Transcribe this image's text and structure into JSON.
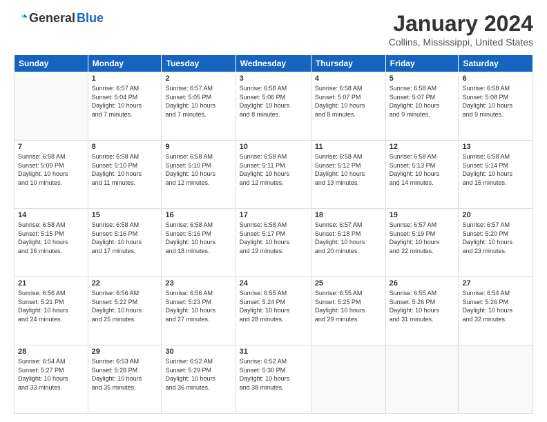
{
  "logo": {
    "general": "General",
    "blue": "Blue"
  },
  "title": "January 2024",
  "location": "Collins, Mississippi, United States",
  "headers": [
    "Sunday",
    "Monday",
    "Tuesday",
    "Wednesday",
    "Thursday",
    "Friday",
    "Saturday"
  ],
  "weeks": [
    [
      {
        "day": "",
        "info": ""
      },
      {
        "day": "1",
        "info": "Sunrise: 6:57 AM\nSunset: 5:04 PM\nDaylight: 10 hours\nand 7 minutes."
      },
      {
        "day": "2",
        "info": "Sunrise: 6:57 AM\nSunset: 5:05 PM\nDaylight: 10 hours\nand 7 minutes."
      },
      {
        "day": "3",
        "info": "Sunrise: 6:58 AM\nSunset: 5:06 PM\nDaylight: 10 hours\nand 8 minutes."
      },
      {
        "day": "4",
        "info": "Sunrise: 6:58 AM\nSunset: 5:07 PM\nDaylight: 10 hours\nand 8 minutes."
      },
      {
        "day": "5",
        "info": "Sunrise: 6:58 AM\nSunset: 5:07 PM\nDaylight: 10 hours\nand 9 minutes."
      },
      {
        "day": "6",
        "info": "Sunrise: 6:58 AM\nSunset: 5:08 PM\nDaylight: 10 hours\nand 9 minutes."
      }
    ],
    [
      {
        "day": "7",
        "info": "Sunrise: 6:58 AM\nSunset: 5:09 PM\nDaylight: 10 hours\nand 10 minutes."
      },
      {
        "day": "8",
        "info": "Sunrise: 6:58 AM\nSunset: 5:10 PM\nDaylight: 10 hours\nand 11 minutes."
      },
      {
        "day": "9",
        "info": "Sunrise: 6:58 AM\nSunset: 5:10 PM\nDaylight: 10 hours\nand 12 minutes."
      },
      {
        "day": "10",
        "info": "Sunrise: 6:58 AM\nSunset: 5:11 PM\nDaylight: 10 hours\nand 12 minutes."
      },
      {
        "day": "11",
        "info": "Sunrise: 6:58 AM\nSunset: 5:12 PM\nDaylight: 10 hours\nand 13 minutes."
      },
      {
        "day": "12",
        "info": "Sunrise: 6:58 AM\nSunset: 5:13 PM\nDaylight: 10 hours\nand 14 minutes."
      },
      {
        "day": "13",
        "info": "Sunrise: 6:58 AM\nSunset: 5:14 PM\nDaylight: 10 hours\nand 15 minutes."
      }
    ],
    [
      {
        "day": "14",
        "info": "Sunrise: 6:58 AM\nSunset: 5:15 PM\nDaylight: 10 hours\nand 16 minutes."
      },
      {
        "day": "15",
        "info": "Sunrise: 6:58 AM\nSunset: 5:16 PM\nDaylight: 10 hours\nand 17 minutes."
      },
      {
        "day": "16",
        "info": "Sunrise: 6:58 AM\nSunset: 5:16 PM\nDaylight: 10 hours\nand 18 minutes."
      },
      {
        "day": "17",
        "info": "Sunrise: 6:58 AM\nSunset: 5:17 PM\nDaylight: 10 hours\nand 19 minutes."
      },
      {
        "day": "18",
        "info": "Sunrise: 6:57 AM\nSunset: 5:18 PM\nDaylight: 10 hours\nand 20 minutes."
      },
      {
        "day": "19",
        "info": "Sunrise: 6:57 AM\nSunset: 5:19 PM\nDaylight: 10 hours\nand 22 minutes."
      },
      {
        "day": "20",
        "info": "Sunrise: 6:57 AM\nSunset: 5:20 PM\nDaylight: 10 hours\nand 23 minutes."
      }
    ],
    [
      {
        "day": "21",
        "info": "Sunrise: 6:56 AM\nSunset: 5:21 PM\nDaylight: 10 hours\nand 24 minutes."
      },
      {
        "day": "22",
        "info": "Sunrise: 6:56 AM\nSunset: 5:22 PM\nDaylight: 10 hours\nand 25 minutes."
      },
      {
        "day": "23",
        "info": "Sunrise: 6:56 AM\nSunset: 5:23 PM\nDaylight: 10 hours\nand 27 minutes."
      },
      {
        "day": "24",
        "info": "Sunrise: 6:55 AM\nSunset: 5:24 PM\nDaylight: 10 hours\nand 28 minutes."
      },
      {
        "day": "25",
        "info": "Sunrise: 6:55 AM\nSunset: 5:25 PM\nDaylight: 10 hours\nand 29 minutes."
      },
      {
        "day": "26",
        "info": "Sunrise: 6:55 AM\nSunset: 5:26 PM\nDaylight: 10 hours\nand 31 minutes."
      },
      {
        "day": "27",
        "info": "Sunrise: 6:54 AM\nSunset: 5:26 PM\nDaylight: 10 hours\nand 32 minutes."
      }
    ],
    [
      {
        "day": "28",
        "info": "Sunrise: 6:54 AM\nSunset: 5:27 PM\nDaylight: 10 hours\nand 33 minutes."
      },
      {
        "day": "29",
        "info": "Sunrise: 6:53 AM\nSunset: 5:28 PM\nDaylight: 10 hours\nand 35 minutes."
      },
      {
        "day": "30",
        "info": "Sunrise: 6:52 AM\nSunset: 5:29 PM\nDaylight: 10 hours\nand 36 minutes."
      },
      {
        "day": "31",
        "info": "Sunrise: 6:52 AM\nSunset: 5:30 PM\nDaylight: 10 hours\nand 38 minutes."
      },
      {
        "day": "",
        "info": ""
      },
      {
        "day": "",
        "info": ""
      },
      {
        "day": "",
        "info": ""
      }
    ]
  ]
}
